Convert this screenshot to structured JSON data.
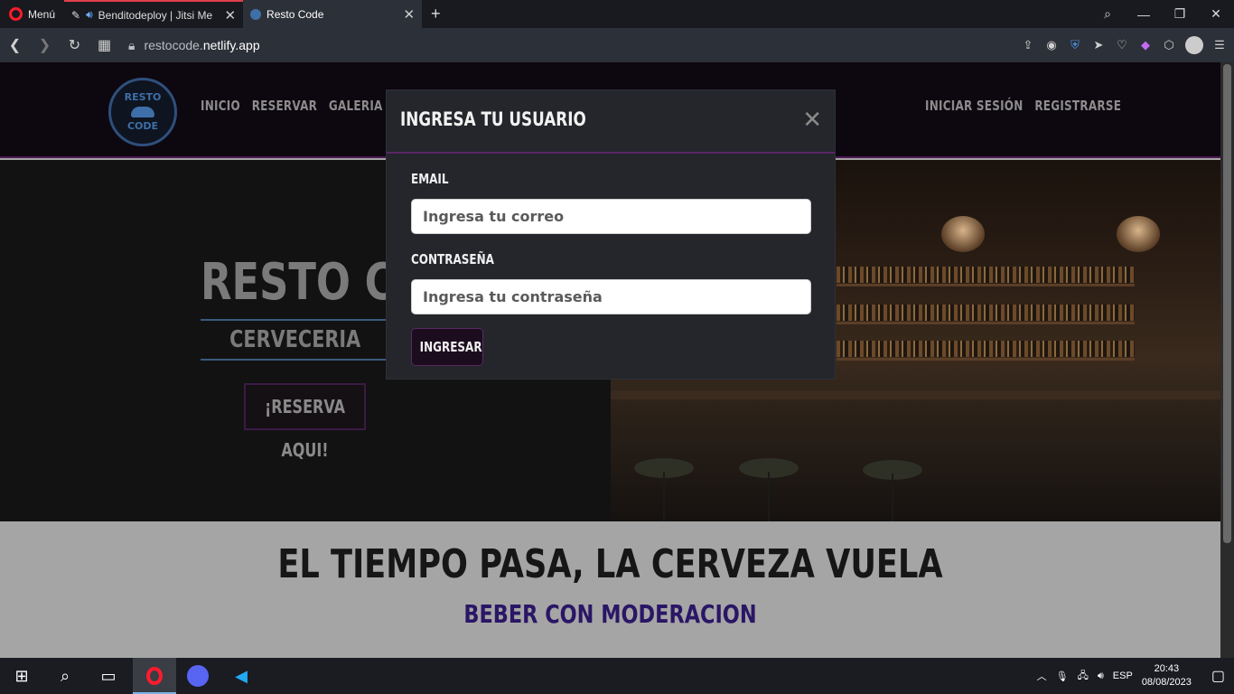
{
  "browser": {
    "menu_label": "Menú",
    "tabs": [
      {
        "title": "Benditodeploy | Jitsi Me"
      },
      {
        "title": "Resto Code"
      }
    ],
    "url_prefix": "restocode.",
    "url_domain": "netlify.app"
  },
  "site": {
    "logo_top": "RESTO",
    "logo_bottom": "CODE",
    "nav_left": [
      "INICIO",
      "RESERVAR",
      "GALERIA"
    ],
    "nav_right": [
      "INICIAR SESIÓN",
      "REGISTRARSE"
    ],
    "hero_title": "RESTO CODE",
    "hero_subtitle": "CERVECERIA",
    "hero_button": "¡RESERVA AQUI!",
    "tagline": "EL TIEMPO PASA, LA CERVEZA VUELA",
    "tagline2": "BEBER CON MODERACION"
  },
  "modal": {
    "title": "INGRESA TU USUARIO",
    "email_label": "EMAIL",
    "email_placeholder": "Ingresa tu correo",
    "password_label": "CONTRASEÑA",
    "password_placeholder": "Ingresa tu contraseña",
    "submit_label": "INGRESAR"
  },
  "taskbar": {
    "language": "ESP",
    "time": "20:43",
    "date": "08/08/2023"
  },
  "colors": {
    "accent_purple": "#5b2565",
    "nav_bg": "#0d0710",
    "tagline2": "#2a1666"
  }
}
